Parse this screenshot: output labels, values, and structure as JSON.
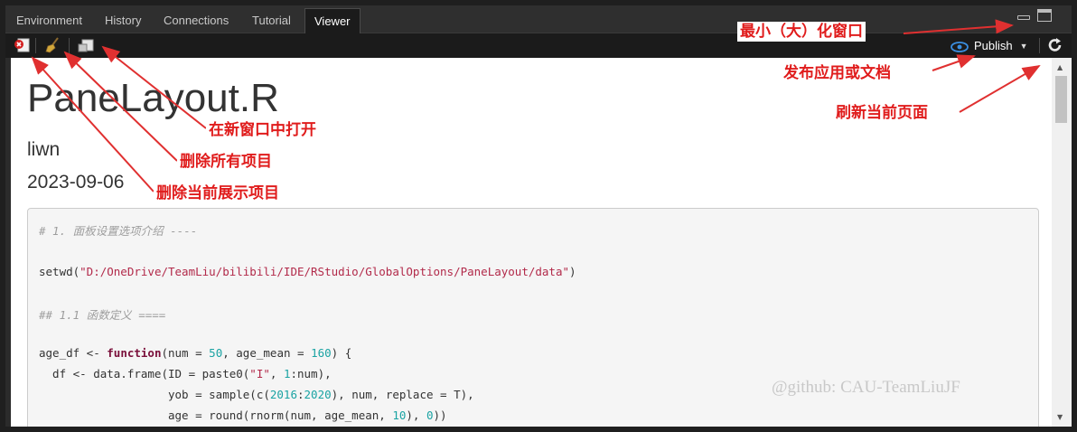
{
  "tabs": [
    "Environment",
    "History",
    "Connections",
    "Tutorial",
    "Viewer"
  ],
  "active_tab": "Viewer",
  "toolbar": {
    "remove_current_icon": "remove-current-item-icon",
    "clear_all_icon": "broom-icon",
    "open_new_window_icon": "popout-icon",
    "publish_label": "Publish",
    "refresh_icon": "refresh-icon"
  },
  "document": {
    "title": "PaneLayout.R",
    "author": "liwn",
    "date": "2023-09-06"
  },
  "code": {
    "line1": "# 1. 面板设置选项介绍 ----",
    "line2_prefix": "setwd(",
    "line2_string": "\"D:/OneDrive/TeamLiu/bilibili/IDE/RStudio/GlobalOptions/PaneLayout/data\"",
    "line2_suffix": ")",
    "line3": "## 1.1 函数定义 ====",
    "line4_a": "age_df <- ",
    "line4_kw": "function",
    "line4_b": "(num = ",
    "line4_n1": "50",
    "line4_c": ", age_mean = ",
    "line4_n2": "160",
    "line4_d": ") {",
    "line5_a": "  df <- data.frame(ID = paste0(",
    "line5_str": "\"I\"",
    "line5_b": ", ",
    "line5_n": "1",
    "line5_c": ":num),",
    "line6_a": "                   yob = sample(c(",
    "line6_n1": "2016",
    "line6_b": ":",
    "line6_n2": "2020",
    "line6_c": "), num, replace = T),",
    "line7_a": "                   age = round(rnorm(num, age_mean, ",
    "line7_n1": "10",
    "line7_b": "), ",
    "line7_n2": "0",
    "line7_c": "))"
  },
  "watermark": "@github: CAU-TeamLiuJF",
  "annotations": {
    "min_max": "最小（大）化窗口",
    "publish": "发布应用或文档",
    "refresh": "刷新当前页面",
    "open_new_window": "在新窗口中打开",
    "remove_all": "删除所有项目",
    "remove_current": "删除当前展示项目"
  },
  "colors": {
    "annotation_text": "#e01c1c",
    "arrow": "#e03030",
    "active_tab_bg": "#1b1b1b",
    "code_comment": "#9e9e9e",
    "code_string": "#b22a4a",
    "code_number": "#1aa3a3",
    "code_keyword": "#7a0f3a"
  }
}
